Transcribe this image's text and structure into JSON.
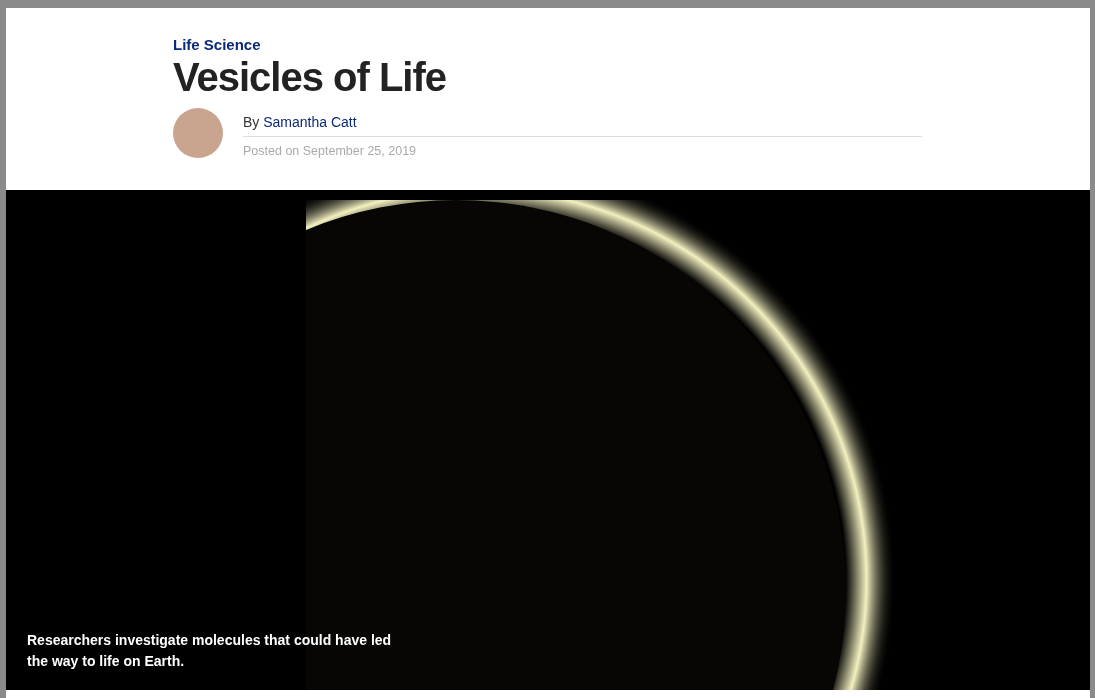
{
  "article": {
    "category": "Life Science",
    "title": "Vesicles of Life",
    "byline_prefix": "By",
    "author": "Samantha Catt",
    "posted": "Posted on September 25, 2019"
  },
  "hero": {
    "caption": "Researchers investigate molecules that could have led the way to life on Earth."
  }
}
